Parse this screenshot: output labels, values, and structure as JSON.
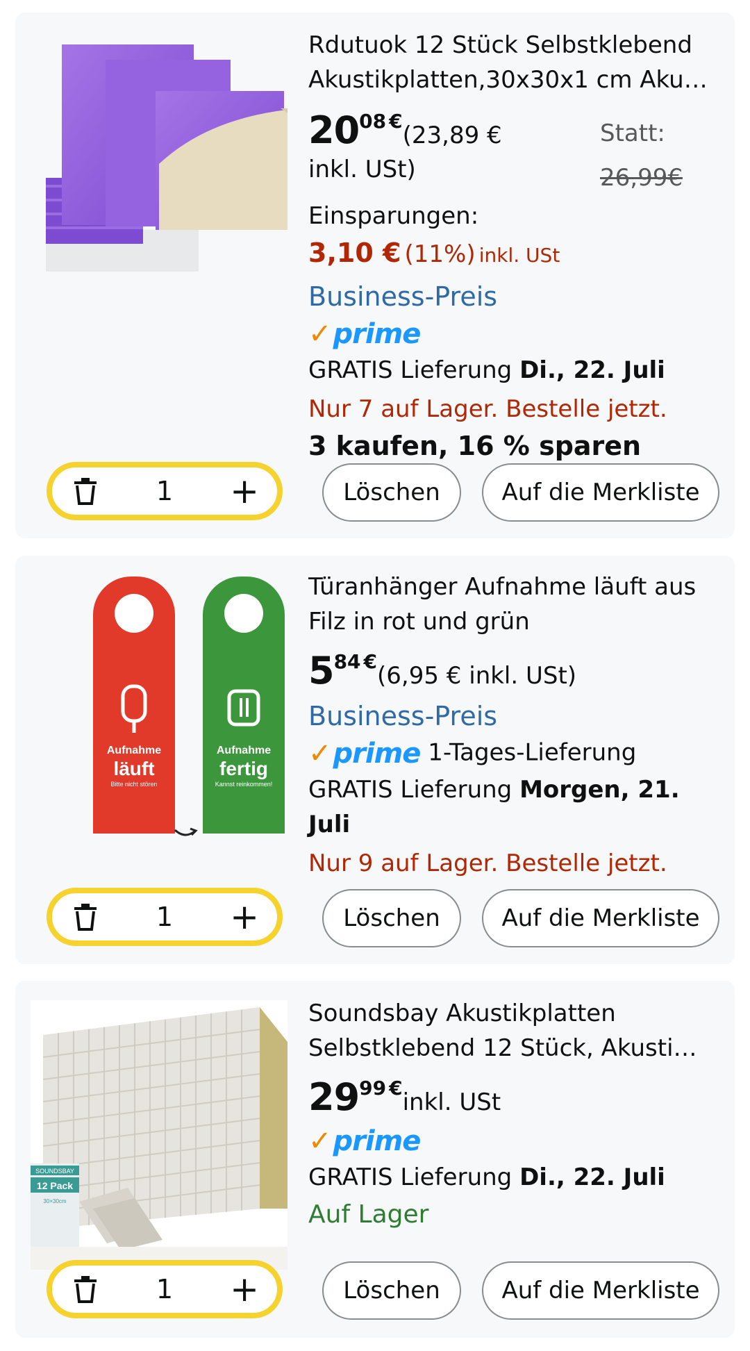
{
  "cart": {
    "items": [
      {
        "title_line1": "Rdutuok 12 Stück Selbstklebend",
        "title_line2": "Akustikplatten,30x30x1 cm Aku…",
        "price_whole": "20",
        "price_fraction": "08",
        "currency": "€",
        "price_gross_line1": "(23,89 €",
        "price_gross_line2": "inkl. USt)",
        "was_label": "Statt:",
        "was_price": "26,99€",
        "savings_label": "Einsparungen:",
        "savings_amount": "3,10 €",
        "savings_percent": "(11%)",
        "savings_vat": "inkl. USt",
        "business_label": "Business-Preis",
        "prime_label": "prime",
        "delivery_prefix": "GRATIS Lieferung",
        "delivery_date": "Di., 22. Juli",
        "stock_text": "Nur 7 auf Lager. Bestelle jetzt.",
        "deal_text": "3 kaufen, 16 % sparen",
        "quantity": "1",
        "delete_label": "Löschen",
        "save_label": "Auf die Merkliste"
      },
      {
        "title_line1": "Türanhänger Aufnahme läuft aus",
        "title_line2": "Filz in rot und grün",
        "price_whole": "5",
        "price_fraction": "84",
        "currency": "€",
        "price_gross": "(6,95 € inkl. USt)",
        "business_label": "Business-Preis",
        "prime_label": "prime",
        "prime_extra": "1-Tages-Lieferung",
        "delivery_prefix": "GRATIS Lieferung",
        "delivery_date_line1": "Morgen, 21.",
        "delivery_date_line2": "Juli",
        "stock_text": "Nur 9 auf Lager. Bestelle jetzt.",
        "hanger_red_line1": "Aufnahme",
        "hanger_red_line2": "läuft",
        "hanger_red_line3": "Bitte nicht stören",
        "hanger_green_line1": "Aufnahme",
        "hanger_green_line2": "fertig",
        "hanger_green_line3": "Kannst reinkommen!",
        "quantity": "1",
        "delete_label": "Löschen",
        "save_label": "Auf die Merkliste"
      },
      {
        "title_line1": "Soundsbay Akustikplatten",
        "title_line2": "Selbstklebend 12 Stück, Akusti…",
        "price_whole": "29",
        "price_fraction": "99",
        "currency": "€",
        "price_gross": "inkl. USt",
        "prime_label": "prime",
        "delivery_prefix": "GRATIS Lieferung",
        "delivery_date": "Di., 22. Juli",
        "stock_text": "Auf Lager",
        "pack_brand": "SOUNDSBAY",
        "pack_label": "12 Pack",
        "pack_size": "30×30cm",
        "quantity": "1",
        "delete_label": "Löschen",
        "save_label": "Auf die Merkliste"
      }
    ]
  },
  "colors": {
    "card_bg": "#f7f8fa",
    "stepper_border": "#f6d22f",
    "price_red": "#b12704",
    "business_blue": "#2f6aa6",
    "prime_blue": "#1a98ff",
    "prime_orange": "#f08804",
    "in_stock_green": "#2e7d32"
  },
  "icons": [
    "trash-icon",
    "plus-icon",
    "prime-check-icon"
  ]
}
